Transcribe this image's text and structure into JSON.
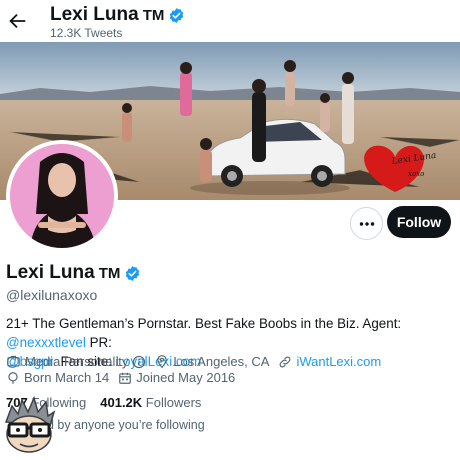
{
  "header": {
    "name": "Lexi Luna",
    "tm": "TM",
    "tweet_count": "12.3K",
    "tweet_label": "Tweets"
  },
  "profile": {
    "name": "Lexi Luna",
    "tm": "TM",
    "handle": "@lexilunaxoxo",
    "verified": true,
    "bio": {
      "text1": "21+ The Gentleman’s Pornstar. Best Fake Boobs in the Biz. Agent: ",
      "mention1": "@nexxxtlevel",
      "text2": " PR:",
      "mention2": "@bsgpr",
      "text3": "  Fan site: ",
      "fansite": "LoyalLexi.com"
    },
    "category": "Media Personality",
    "location": "Los Angeles, CA",
    "website": "iWantLexi.com",
    "birthday": "Born March 14",
    "joined": "Joined May 2016"
  },
  "stats": {
    "following_count": "707",
    "following_label": "Following",
    "followers_count": "401.2K",
    "followers_label": "Followers"
  },
  "followed_note": "ed by anyone you’re following",
  "buttons": {
    "follow": "Follow",
    "more": "•••"
  },
  "banner_heart_text": "Lexi Luna\nxoxo",
  "colors": {
    "accent": "#1d9bf0",
    "text_primary": "#0f1419",
    "text_secondary": "#536471",
    "follow_bg": "#0f1419",
    "avatar_bg": "#ee9fd2"
  },
  "icons": [
    "back-arrow-icon",
    "verified-badge-icon",
    "more-icon",
    "info-icon",
    "location-icon",
    "link-icon",
    "birthday-icon",
    "calendar-icon"
  ]
}
